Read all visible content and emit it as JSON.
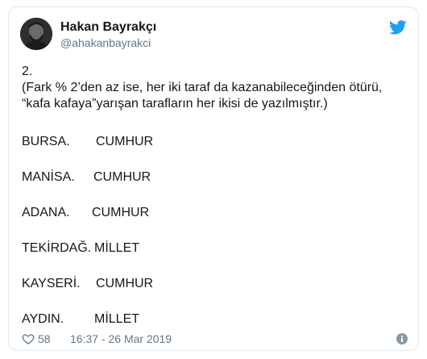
{
  "user": {
    "display_name": "Hakan Bayrakçı",
    "handle": "@ahakanbayrakci"
  },
  "tweet": {
    "lines": [
      "2.",
      "(Fark % 2’den az ise, her iki taraf da kazanabileceğinden ötürü,",
      "“kafa kafaya”yarışan tarafların her ikisi de yazılmıştır.)"
    ],
    "results": [
      {
        "city": "BURSA.",
        "winner": "CUMHUR"
      },
      {
        "city": "MANİSA.",
        "winner": "CUMHUR"
      },
      {
        "city": "ADANA.",
        "winner": "CUMHUR"
      },
      {
        "city": "TEKİRDAĞ.",
        "winner": "MİLLET"
      },
      {
        "city": "KAYSERİ.",
        "winner": "CUMHUR"
      },
      {
        "city": "AYDIN.",
        "winner": "MİLLET"
      }
    ]
  },
  "footer": {
    "likes": "58",
    "timestamp": "16:37 - 26 Mar 2019"
  },
  "icons": {
    "brand": "twitter-bird-icon",
    "like": "heart-icon",
    "info": "info-icon"
  },
  "colors": {
    "twitter_blue": "#1da1f2",
    "text": "#14171a",
    "secondary_text": "#657786",
    "border": "#e1e8ed"
  }
}
